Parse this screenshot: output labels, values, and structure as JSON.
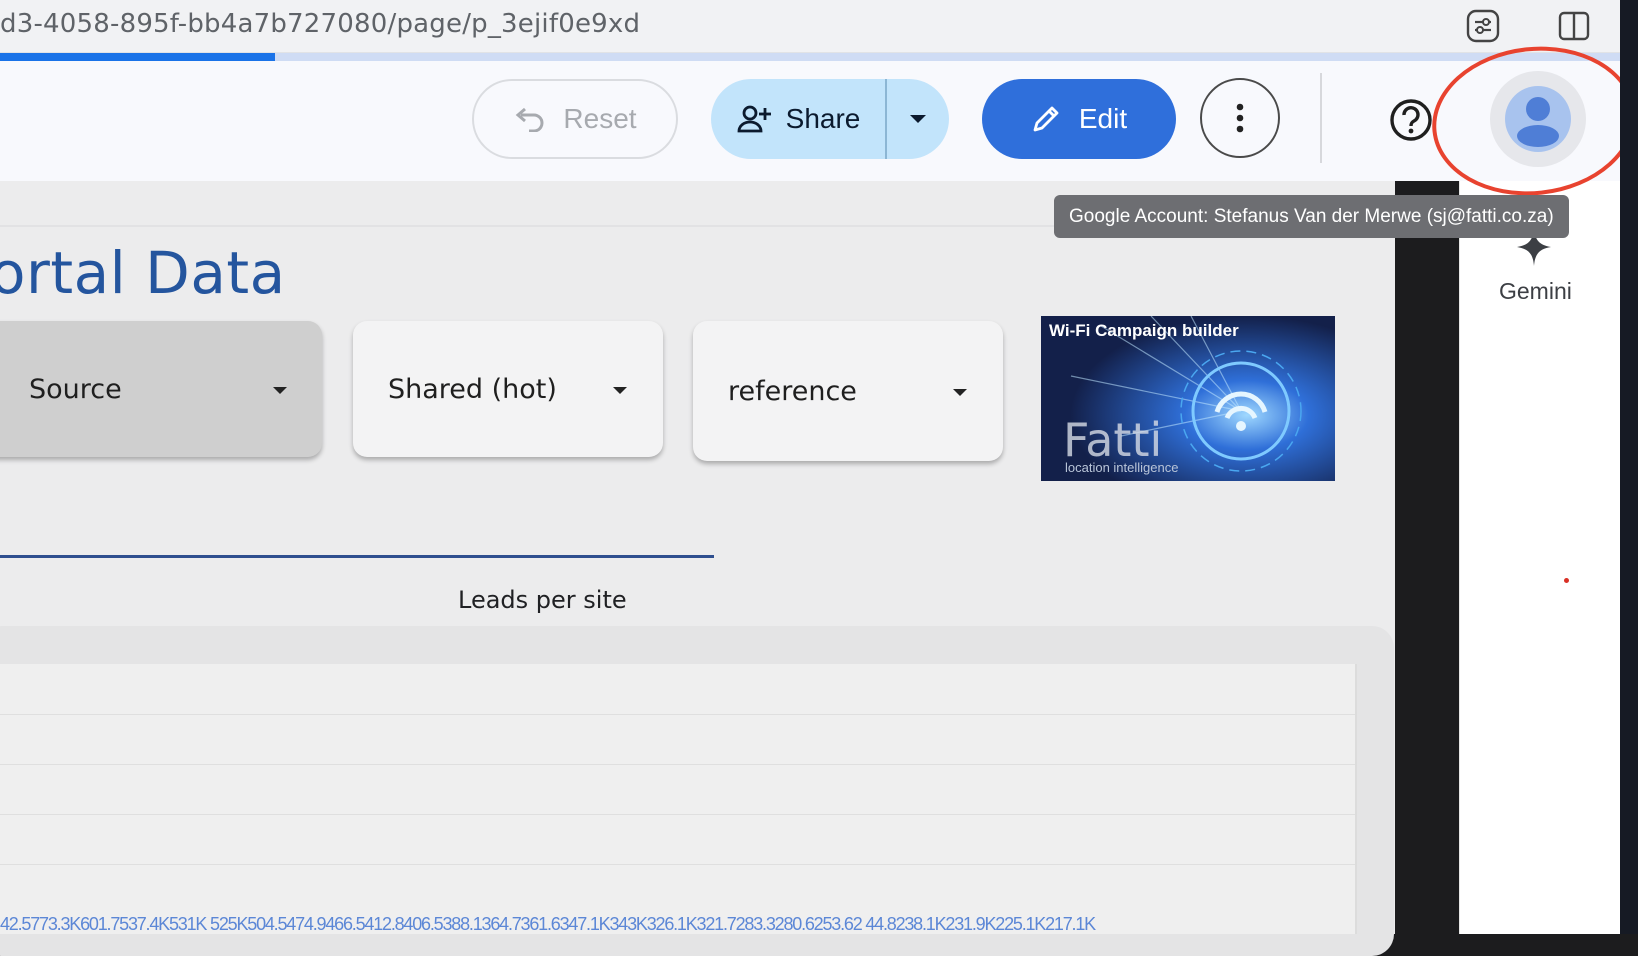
{
  "browser": {
    "url": "d3-4058-895f-bb4a7b727080/page/p_3ejif0e9xd",
    "load_progress": 0.17,
    "icons": [
      "page-settings-icon",
      "split-view-icon"
    ]
  },
  "toolbar": {
    "reset_label": "Reset",
    "share_label": "Share",
    "edit_label": "Edit",
    "account_tooltip": "Google Account: Stefanus Van der Merwe (sj@fatti.co.za)"
  },
  "report": {
    "title": "ortal Data",
    "filters": [
      {
        "label": "Source"
      },
      {
        "label": "Shared (hot)"
      },
      {
        "label": "reference"
      }
    ],
    "image": {
      "heading": "Wi-Fi Campaign builder",
      "logo_text": "Fatti",
      "logo_subtext": "location intelligence"
    }
  },
  "chart_data": {
    "type": "bar",
    "title": "Leads per site",
    "tick_text": "42.5773.3K601.7537.4K531K 525K504.5474.9466.5412.8406.5388.1364.7361.6347.1K343K326.1K321.7283.3280.6253.62 44.8238.1K231.9K225.1K217.1K"
  },
  "side_panel": {
    "gemini_label": "Gemini"
  },
  "colors": {
    "accent": "#2f6fdb",
    "share_bg": "#c2e4fb",
    "title": "#24559e",
    "highlight": "#e8432f"
  }
}
